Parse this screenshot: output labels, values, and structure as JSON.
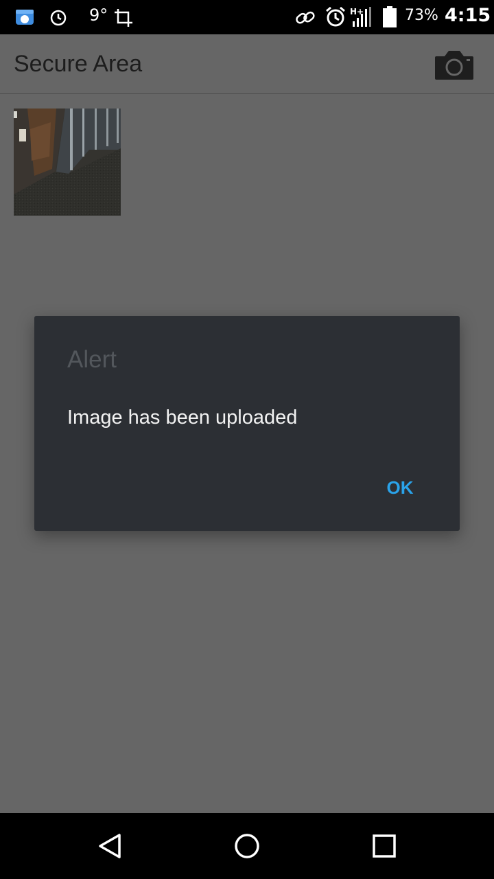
{
  "status_bar": {
    "icons": [
      "cloud-app-icon",
      "alarm-icon",
      "weather-icon",
      "crop-icon",
      "link-icon",
      "alarm-clock-icon",
      "signal-icon",
      "battery-icon"
    ],
    "temperature": "9°",
    "battery_percent": "73%",
    "time": "4:15"
  },
  "app_bar": {
    "title": "Secure Area",
    "action_icon": "camera-icon"
  },
  "gallery": {
    "items": [
      {
        "description_icon": "photo-thumbnail"
      }
    ]
  },
  "dialog": {
    "title": "Alert",
    "message": "Image has been uploaded",
    "ok_label": "OK"
  },
  "nav_bar": {
    "buttons": [
      "back-icon",
      "home-icon",
      "recents-icon"
    ]
  },
  "colors": {
    "scrim": "#666666",
    "dialog_bg": "#2c2f34",
    "accent": "#2aa3ea"
  }
}
